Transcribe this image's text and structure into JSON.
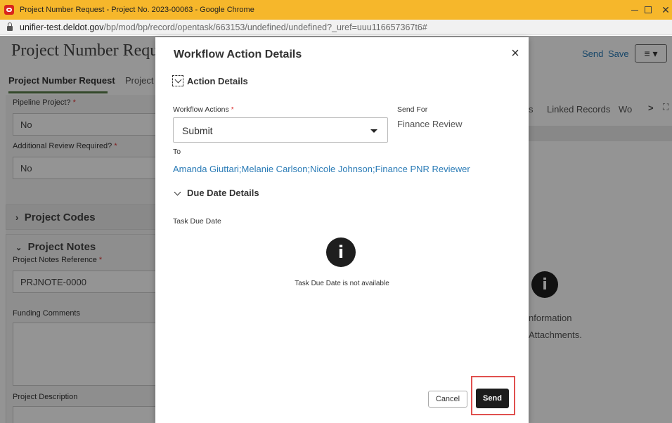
{
  "window": {
    "title": "Project Number Request - Project No. 2023-00063 - Google Chrome",
    "url_host": "unifier-test.deldot.gov",
    "url_path": "/bp/mod/bp/record/opentask/663153/undefined/undefined?_uref=uuu116657367t6#",
    "app_icon": "oracle-icon"
  },
  "app": {
    "page_title": "Project Number Request",
    "header_send": "Send",
    "header_save": "Save",
    "menu_glyph": "≡ ▾",
    "tabs": [
      "Project Number Request",
      "Project"
    ],
    "fields": {
      "pipeline_label": "Pipeline Project?",
      "pipeline_value": "No",
      "additional_review_label": "Additional Review Required?",
      "additional_review_value": "No",
      "project_codes_section": "Project Codes",
      "project_notes_section": "Project Notes",
      "notes_ref_label": "Project Notes Reference",
      "notes_ref_value": "PRJNOTE-0000",
      "funding_label": "Funding Comments",
      "description_label": "Project Description",
      "required_mark": "*"
    },
    "right_panel": {
      "tab_fragment": "s",
      "linked_records": "Linked Records",
      "wo_fragment": "Wo",
      "next": ">",
      "info_line1": "nformation",
      "info_line2": "Attachments."
    }
  },
  "dialog": {
    "title": "Workflow Action Details",
    "close": "×",
    "action_details": "Action Details",
    "workflow_actions_label": "Workflow Actions",
    "workflow_actions_value": "Submit",
    "send_for_label": "Send For",
    "send_for_value": "Finance Review",
    "to_label": "To",
    "to_value": "Amanda Giuttari;Melanie Carlson;Nicole Johnson;Finance PNR Reviewer",
    "due_date_details": "Due Date Details",
    "task_due_date_label": "Task Due Date",
    "info_glyph": "i",
    "task_due_date_message": "Task Due Date is not available",
    "cancel": "Cancel",
    "send": "Send"
  }
}
